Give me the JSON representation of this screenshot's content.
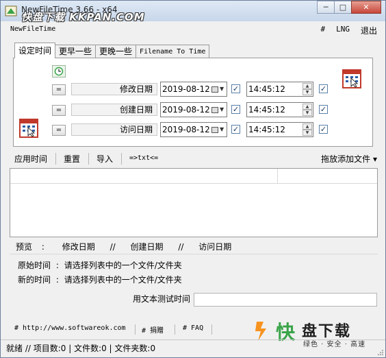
{
  "titlebar": {
    "title": "NewFileTime 3.66 - x64",
    "watermark": "快盘下载 KKPAN.COM",
    "minimize": "─",
    "maximize": "□",
    "close": "✕"
  },
  "menu": {
    "app_label": "NewFileTime",
    "hash": "#",
    "lng": "LNG",
    "exit": "退出"
  },
  "tabs": [
    {
      "label": "设定时间"
    },
    {
      "label": "更早一些"
    },
    {
      "label": "更晚一些"
    },
    {
      "label": "Filename To Time"
    }
  ],
  "rows": [
    {
      "eq": "=",
      "label": "修改日期",
      "colon": ":",
      "date": "2019-08-12",
      "time": "14:45:12",
      "check": "✓"
    },
    {
      "eq": "=",
      "label": "创建日期",
      "colon": ":",
      "date": "2019-08-12",
      "time": "14:45:12",
      "check": "✓"
    },
    {
      "eq": "=",
      "label": "访问日期",
      "colon": ":",
      "date": "2019-08-12",
      "time": "14:45:12",
      "check": "✓"
    }
  ],
  "toolbar": {
    "apply": "应用时间",
    "reset": "重置",
    "import": "导入",
    "txt": "=>txt<=",
    "drag_add": "拖放添加文件 ▾"
  },
  "preview": {
    "label": "预览",
    "colon": ":",
    "modify": "修改日期",
    "sep": "//",
    "create": "创建日期",
    "access": "访问日期"
  },
  "info": {
    "original_label": "原始时间",
    "new_label": "新的时间",
    "colon": ":",
    "original_value": "请选择列表中的一个文件/文件夹",
    "new_value": "请选择列表中的一个文件/文件夹"
  },
  "test": {
    "label": "用文本测试时间",
    "value": ""
  },
  "links": {
    "website": "# http://www.softwareok.com",
    "donate": "# 捐赠",
    "faq": "# FAQ"
  },
  "status": {
    "text": "就绪 // 项目数:0 | 文件数:0 | 文件夹数:0"
  },
  "brand": {
    "name": "盘下载",
    "slogan": "绿色 · 安全 · 高速",
    "logo_char": "快"
  },
  "colors": {
    "accent": "#5a7fa8",
    "calendar_red": "#c0392b",
    "brand_orange": "#f7931e",
    "brand_green": "#3aa44a"
  }
}
